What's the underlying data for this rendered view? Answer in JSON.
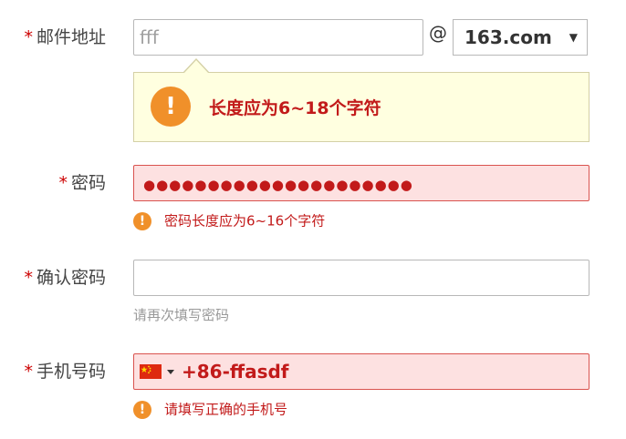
{
  "email": {
    "label": "邮件地址",
    "required_mark": "*",
    "value": "fff",
    "at_sign": "@",
    "domain_selected": "163.com",
    "dropdown_arrow": "▼",
    "tooltip": {
      "icon": "!",
      "text": "长度应为6~18个字符"
    }
  },
  "password": {
    "label": "密码",
    "required_mark": "*",
    "masked_value": "●●●●●●●●●●●●●●●●●●●●●",
    "error_icon": "!",
    "error": "密码长度应为6~16个字符"
  },
  "confirm_password": {
    "label": "确认密码",
    "required_mark": "*",
    "value": "",
    "hint": "请再次填写密码"
  },
  "phone": {
    "label": "手机号码",
    "required_mark": "*",
    "flag_icon": "china-flag-icon",
    "value": "+86-ffasdf",
    "error_icon": "!",
    "error": "请填写正确的手机号"
  },
  "colors": {
    "required_star": "#cc0000",
    "error_text": "#c21a1a",
    "error_bg": "#fde1e1",
    "error_border": "#d9534f",
    "tooltip_bg": "#ffffe0",
    "warning_icon": "#f0902a"
  }
}
